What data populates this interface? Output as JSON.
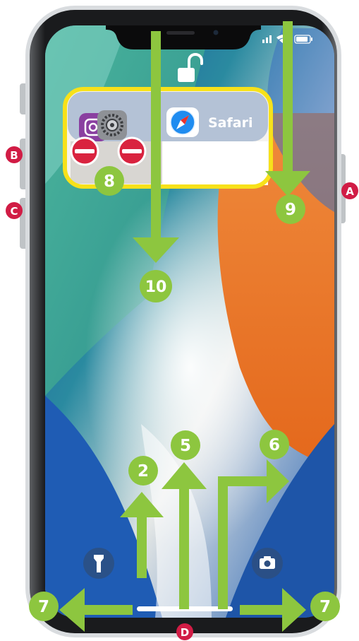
{
  "callouts": {
    "a": "A",
    "b": "B",
    "c": "C",
    "d": "D",
    "n2": "2",
    "n5": "5",
    "n6": "6",
    "n7_left": "7",
    "n7_right": "7",
    "n8": "8",
    "n9": "9",
    "n10": "10"
  },
  "app_switcher": {
    "safari_label": "Safari"
  },
  "colors": {
    "accent_green": "#8dc63f",
    "yellow_frame": "#f7e11a",
    "red_badge": "#d9233f",
    "callout_red": "#d11c45",
    "wallpaper_orange": "#ef7a25",
    "wallpaper_blue": "#1b5fb0",
    "wallpaper_teal": "#45b29a"
  },
  "icons": [
    "lock-open-icon",
    "flashlight-icon",
    "camera-icon",
    "settings-icon",
    "safari-icon",
    "instagram-icon",
    "signal-icon",
    "wifi-icon",
    "battery-icon"
  ]
}
